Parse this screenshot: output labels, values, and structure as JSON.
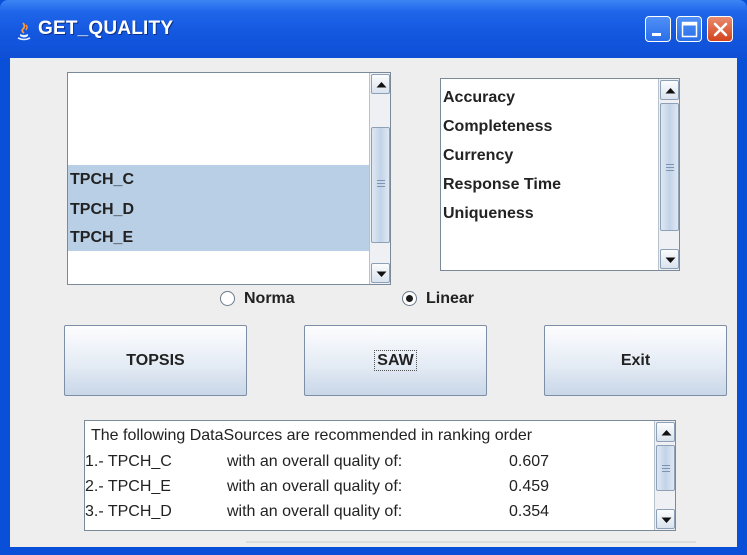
{
  "window": {
    "title": "GET_QUALITY"
  },
  "titlebar_buttons": [
    "minimize",
    "maximize",
    "close"
  ],
  "sources_list": {
    "items": [
      {
        "label": "",
        "selected": false
      },
      {
        "label": "",
        "selected": false
      },
      {
        "label": "TPCH_C",
        "selected": true
      },
      {
        "label": "TPCH_D",
        "selected": true
      },
      {
        "label": "TPCH_E",
        "selected": true
      },
      {
        "label": "",
        "selected": false
      }
    ]
  },
  "criteria_list": {
    "items": [
      "Accuracy",
      "Completeness",
      "Currency",
      "Response Time",
      "Uniqueness"
    ]
  },
  "normalization": {
    "options": [
      {
        "label": "Norma",
        "checked": false
      },
      {
        "label": "Linear",
        "checked": true
      }
    ]
  },
  "buttons": {
    "topsis": "TOPSIS",
    "saw": "SAW",
    "exit": "Exit"
  },
  "results": {
    "header": "The following DataSources are recommended in ranking order",
    "rows": [
      {
        "rank": "1.- TPCH_C",
        "text": "with an overall quality of:",
        "value": "0.607"
      },
      {
        "rank": "2.- TPCH_E",
        "text": "with an overall quality of:",
        "value": "0.459"
      },
      {
        "rank": "3.- TPCH_D",
        "text": "with an overall quality of:",
        "value": "0.354"
      }
    ]
  },
  "colors": {
    "titlebar": "#1458e0",
    "selection": "#b8cfe5",
    "client_bg": "#eeeeee"
  }
}
